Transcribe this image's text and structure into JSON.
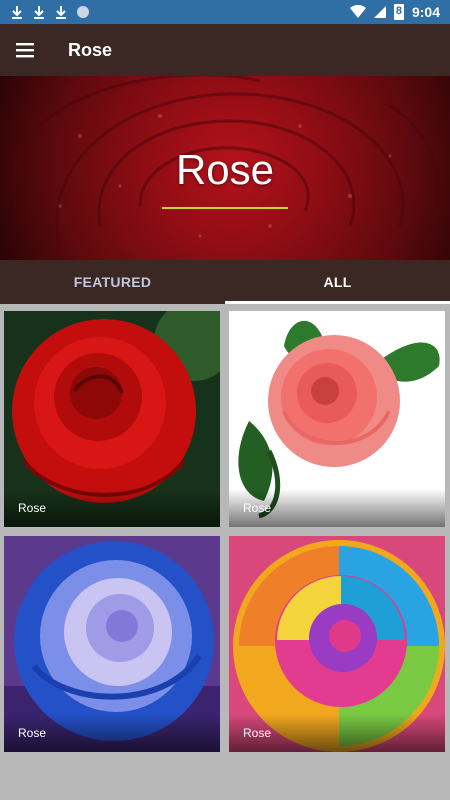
{
  "status_bar": {
    "time": "9:04",
    "battery_level": "8"
  },
  "app_bar": {
    "title": "Rose"
  },
  "hero": {
    "title": "Rose"
  },
  "tabs": [
    {
      "label": "FEATURED",
      "active": false
    },
    {
      "label": "ALL",
      "active": true
    }
  ],
  "grid": {
    "items": [
      {
        "label": "Rose",
        "image": "red-rose"
      },
      {
        "label": "Rose",
        "image": "pink-rose"
      },
      {
        "label": "Rose",
        "image": "blue-rose"
      },
      {
        "label": "Rose",
        "image": "rainbow-rose"
      }
    ]
  },
  "colors": {
    "status_bar": "#2f6fa5",
    "app_bar": "#3b2724",
    "hero_underline": "#c8d63a",
    "grid_background": "#b8b8b8"
  }
}
